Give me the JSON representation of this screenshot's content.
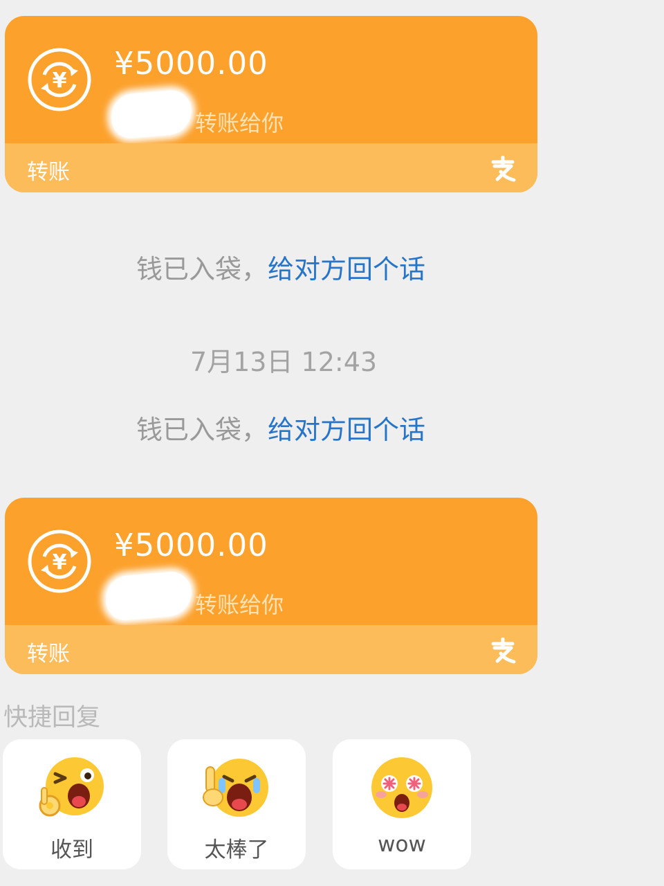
{
  "transfers": [
    {
      "amount": "¥5000.00",
      "subtitle": "转账给你",
      "label": "转账",
      "icon": "yuan-transfer-icon",
      "brand_icon": "alipay-icon"
    },
    {
      "amount": "¥5000.00",
      "subtitle": "转账给你",
      "label": "转账",
      "icon": "yuan-transfer-icon",
      "brand_icon": "alipay-icon"
    }
  ],
  "system_messages": [
    {
      "prefix": "钱已入袋，",
      "link": "给对方回个话"
    },
    {
      "prefix": "钱已入袋，",
      "link": "给对方回个话"
    }
  ],
  "timestamp": "7月13日 12:43",
  "quick_reply": {
    "title": "快捷回复",
    "items": [
      {
        "label": "收到",
        "icon": "ok-wink-emoji-icon"
      },
      {
        "label": "太棒了",
        "icon": "crying-thumbs-up-emoji-icon"
      },
      {
        "label": "wow",
        "icon": "star-eyes-emoji-icon"
      }
    ]
  },
  "colors": {
    "card": "#fca12c",
    "card_footer": "#fcbc5a",
    "link": "#2775c8",
    "background": "#efefef"
  }
}
